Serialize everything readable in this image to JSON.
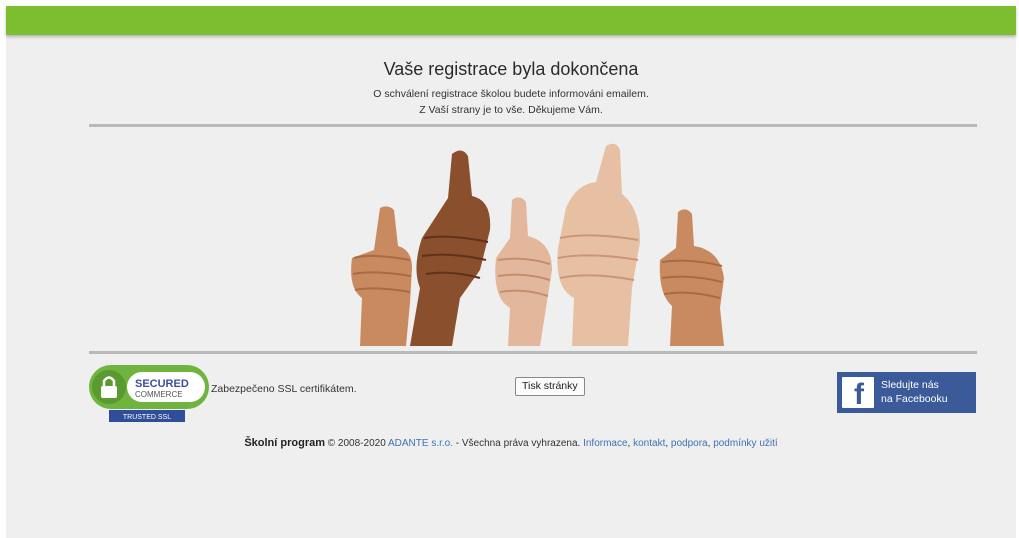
{
  "header": {
    "bar_color": "#7cbe2f"
  },
  "main": {
    "title": "Vaše registrace byla dokončena",
    "message_line1": "O schválení registrace školou budete informováni emailem.",
    "message_line2": "Z Vaší strany je to vše. Děkujeme Vám.",
    "image_icon": "thumbs-up-hands-photo"
  },
  "ssl": {
    "badge_secured": "SECURED",
    "badge_commerce": "COMMERCE",
    "badge_trusted": "TRUSTED SSL",
    "text": "Zabezpečeno SSL certifikátem."
  },
  "print_button": {
    "label": "Tisk stránky"
  },
  "facebook": {
    "logo": "f",
    "line1": "Sledujte nás",
    "line2": "na Facebooku",
    "color": "#3b5a99"
  },
  "footer": {
    "brand": "Školní program",
    "copyright": "© 2008-2020",
    "company_link": "ADANTE s.r.o.",
    "rights": "- Všechna práva vyhrazena.",
    "link_info": "Informace",
    "link_contact": "kontakt",
    "link_support": "podpora",
    "link_terms": "podmínky užití",
    "link_color": "#3f72b3"
  }
}
